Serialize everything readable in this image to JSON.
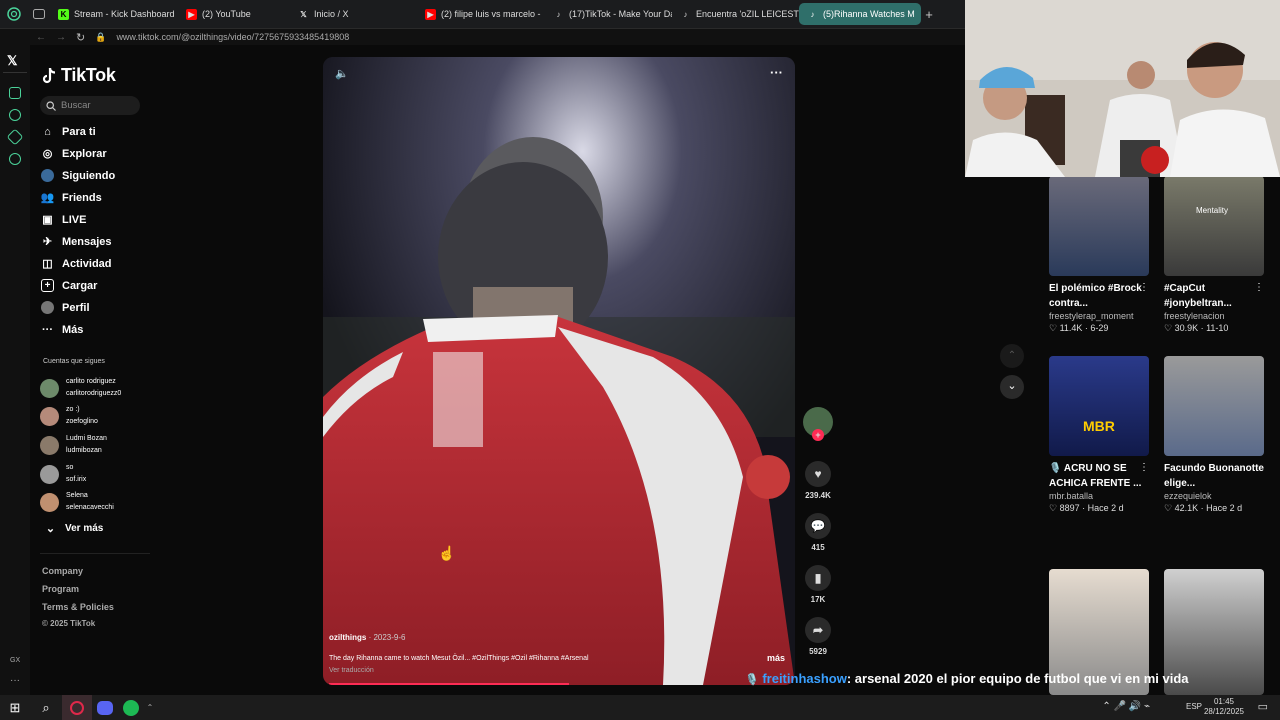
{
  "browser": {
    "tabs": [
      {
        "label": "Stream - Kick Dashboard",
        "icon": "kick-icon",
        "color": "#53fc18"
      },
      {
        "label": "(2) YouTube",
        "icon": "youtube-icon",
        "color": "#ff0000"
      },
      {
        "label": "Inicio / X",
        "icon": "x-icon",
        "color": "#ffffff"
      },
      {
        "label": "(2) filipe luis vs marcelo -",
        "icon": "youtube-icon",
        "color": "#ff0000"
      },
      {
        "label": "(17)TikTok - Make Your Da",
        "icon": "tiktok-icon",
        "color": "#ffffff"
      },
      {
        "label": "Encuentra 'oZIL LEICESTE",
        "icon": "tiktok-icon",
        "color": "#ffffff"
      },
      {
        "label": "(5)Rihanna Watches M",
        "icon": "tiktok-icon",
        "color": "#ffffff",
        "active": true
      }
    ],
    "new_tab": "+",
    "url": "www.tiktok.com/@ozilthings/video/7275675933485419808"
  },
  "sidebar": {
    "logo": "TikTok",
    "search_placeholder": "Buscar",
    "nav": [
      {
        "label": "Para ti",
        "icon": "home-icon"
      },
      {
        "label": "Explorar",
        "icon": "compass-icon"
      },
      {
        "label": "Siguiendo",
        "icon": "following-icon"
      },
      {
        "label": "Friends",
        "icon": "friends-icon"
      },
      {
        "label": "LIVE",
        "icon": "live-icon"
      },
      {
        "label": "Mensajes",
        "icon": "messages-icon"
      },
      {
        "label": "Actividad",
        "icon": "activity-icon"
      },
      {
        "label": "Cargar",
        "icon": "upload-icon"
      },
      {
        "label": "Perfil",
        "icon": "profile-icon"
      },
      {
        "label": "Más",
        "icon": "more-icon"
      }
    ],
    "following_header": "Cuentas que sigues",
    "accounts": [
      {
        "name": "carlito rodriguez",
        "handle": "carlitorodriguezz0",
        "color": "#6d8a6a"
      },
      {
        "name": "zo :)",
        "handle": "zoefoglino",
        "color": "#b58a7a"
      },
      {
        "name": "Ludmi Bozan",
        "handle": "ludmibozan",
        "color": "#8a7a6a"
      },
      {
        "name": "so",
        "handle": "sof.irix",
        "color": "#9a9a9a"
      },
      {
        "name": "Selena",
        "handle": "selenacavecchi",
        "color": "#c09070"
      }
    ],
    "see_more": "Ver más",
    "footer": [
      "Company",
      "Program",
      "Terms & Policies",
      "© 2025 TikTok"
    ]
  },
  "video": {
    "author": "ozilthings",
    "date": "· 2023-9-6",
    "caption": "The day Rihanna came to watch Mesut Özil... #OzilThings #Ozil #Rihanna #Arsenal",
    "more": "más",
    "translate": "Ver traducción"
  },
  "actions": {
    "likes": "239.4K",
    "comments": "415",
    "saves": "17K",
    "shares": "5929"
  },
  "recommended": [
    {
      "title": "El polémico #Brock contra...",
      "author": "freestylerap_moment",
      "stats": "♡ 11.4K · 6-29",
      "thumb": "#3a4a6a",
      "overlay": ""
    },
    {
      "title": "#CapCut #jonybeltran...",
      "author": "freestylenacion",
      "stats": "♡ 30.9K · 11-10",
      "thumb": "#5a5a4a",
      "overlay": "Mentality"
    },
    {
      "title": "🎙️ ACRU NO SE ACHICA FRENTE ...",
      "author": "mbr.batalla",
      "stats": "♡ 8897 · Hace 2 d",
      "thumb": "#1a2a6a",
      "overlay": "MBR"
    },
    {
      "title": "Facundo Buonanotte elige...",
      "author": "ezzequielok",
      "stats": "♡ 42.1K · Hace 2 d",
      "thumb": "#8a8a8a",
      "overlay": ""
    },
    {
      "title": "",
      "author": "",
      "stats": "",
      "thumb": "#c8b8a8",
      "overlay": ""
    },
    {
      "title": "",
      "author": "",
      "stats": "",
      "thumb": "#6a6a6a",
      "overlay": ""
    }
  ],
  "chat": {
    "user": "freitinhashow",
    "message": ": arsenal 2020 el pior equipo de futbol que vi en mi vida"
  },
  "taskbar": {
    "lang": "ESP",
    "time": "01:45",
    "date": "28/12/2025"
  },
  "colors": {
    "accent": "#fe2c55",
    "tab_active": "#2f6f6a",
    "chat_user": "#3aa0ff"
  }
}
